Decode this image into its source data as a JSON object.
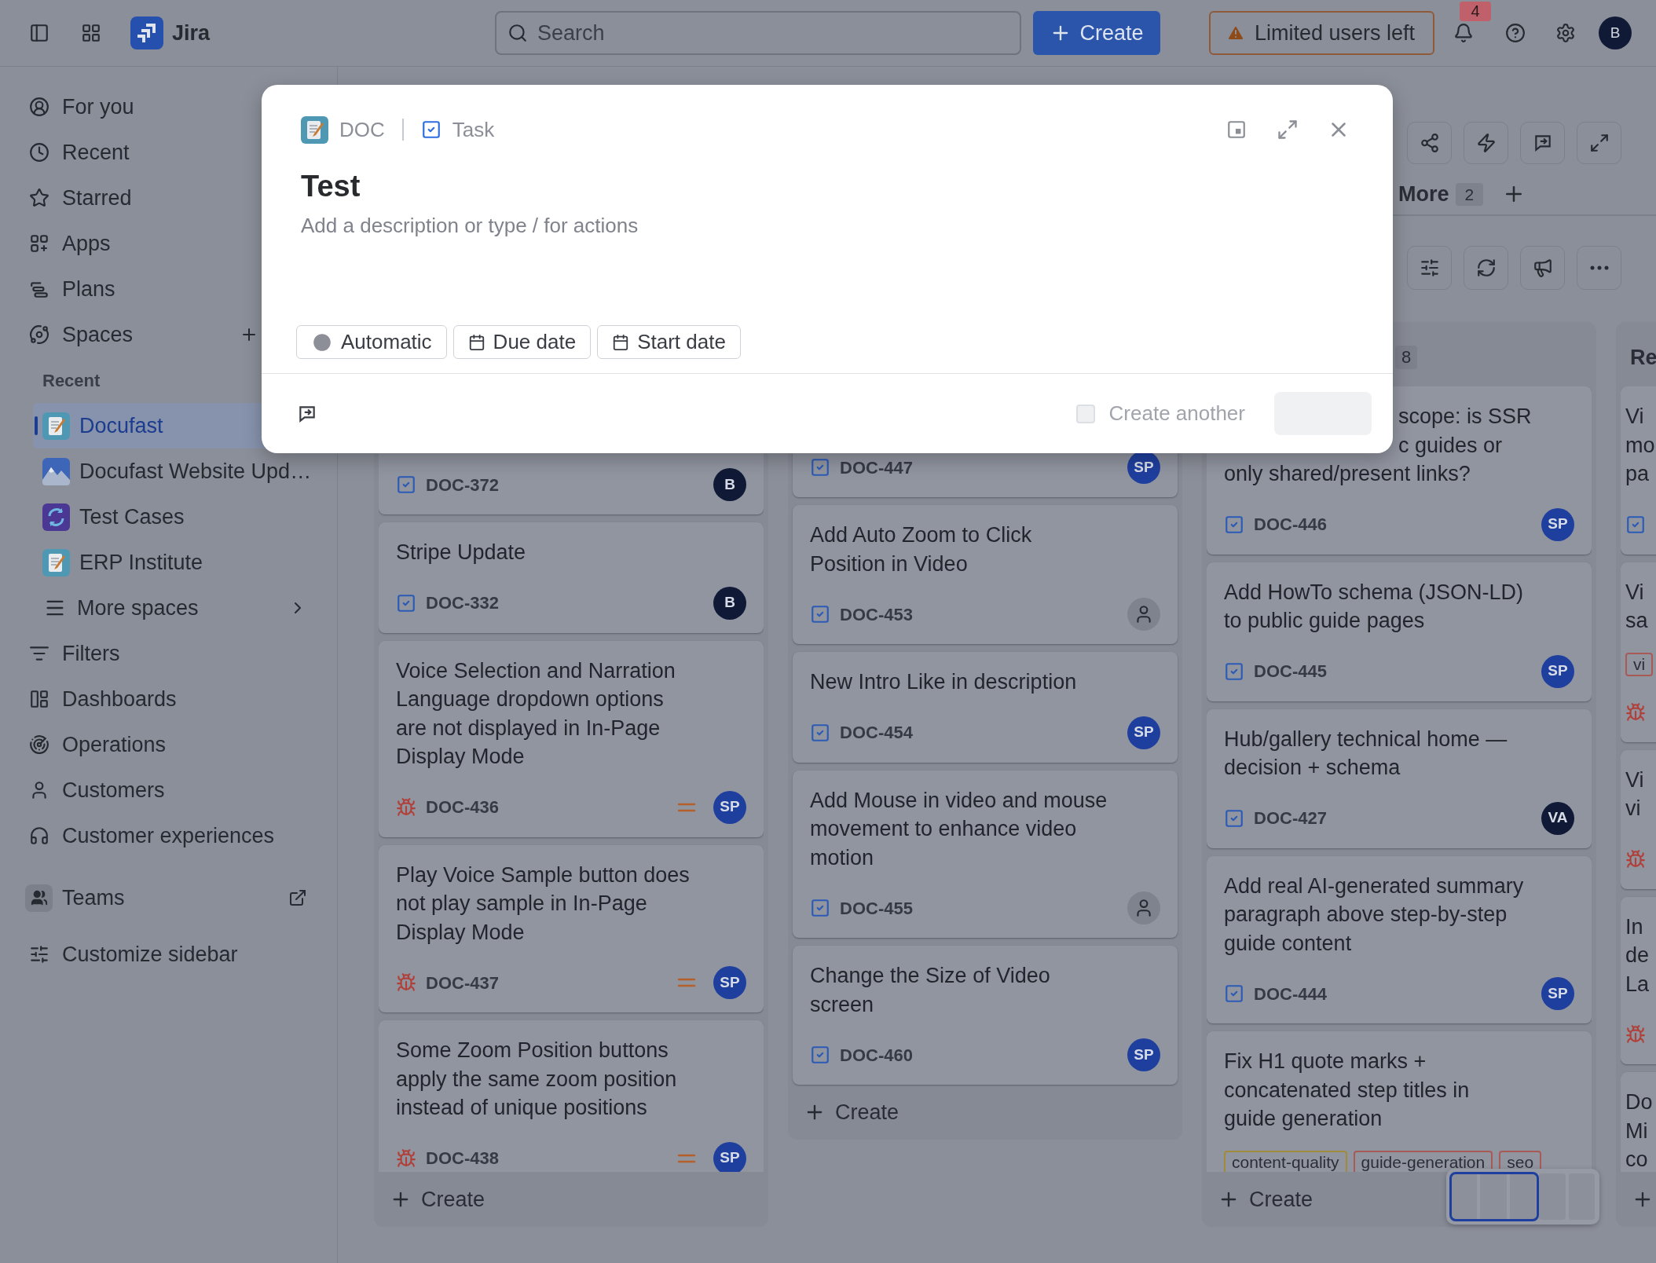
{
  "top_bar": {
    "product": "Jira",
    "search": {
      "placeholder": "Search"
    },
    "create_label": "Create",
    "notice": "Limited users left",
    "notification_count": "4",
    "avatar": "B"
  },
  "sidebar": {
    "nav": [
      {
        "label": "For you"
      },
      {
        "label": "Recent"
      },
      {
        "label": "Starred"
      },
      {
        "label": "Apps"
      },
      {
        "label": "Plans"
      },
      {
        "label": "Spaces"
      }
    ],
    "recent_heading": "Recent",
    "spaces": [
      {
        "label": "Docufast",
        "selected": true
      },
      {
        "label": "Docufast Website Upd…",
        "selected": false
      },
      {
        "label": "Test Cases",
        "selected": false
      },
      {
        "label": "ERP Institute",
        "selected": false
      }
    ],
    "more_spaces": "More spaces",
    "nav_bottom": [
      {
        "label": "Filters"
      },
      {
        "label": "Dashboards"
      },
      {
        "label": "Operations"
      },
      {
        "label": "Customers"
      },
      {
        "label": "Customer experiences"
      }
    ],
    "teams": "Teams",
    "customize": "Customize sidebar"
  },
  "board": {
    "more_tab": {
      "label": "More",
      "count": "2"
    },
    "columns": [
      {
        "create_label": "Create",
        "cards": [
          {
            "key": "DOC-372",
            "kind": "task",
            "assignee": {
              "initials": "B",
              "color": "#101a36"
            }
          },
          {
            "title": "Stripe Update",
            "key": "DOC-332",
            "kind": "task",
            "assignee": {
              "initials": "B",
              "color": "#101a36"
            }
          },
          {
            "title": "Voice Selection and Narration Language dropdown options are not displayed in In-Page Display Mode",
            "key": "DOC-436",
            "kind": "bug",
            "medium_priority": true,
            "assignee": {
              "initials": "SP",
              "color": "#1f3f9e"
            }
          },
          {
            "title": "Play Voice Sample button does not play sample in In-Page Display Mode",
            "key": "DOC-437",
            "kind": "bug",
            "medium_priority": true,
            "assignee": {
              "initials": "SP",
              "color": "#1f3f9e"
            }
          },
          {
            "title": "Some Zoom Position buttons apply the same zoom position instead of unique positions",
            "key": "DOC-438",
            "kind": "bug",
            "medium_priority": true,
            "assignee": {
              "initials": "SP",
              "color": "#1f3f9e"
            }
          }
        ]
      },
      {
        "create_label": "Create",
        "cards": [
          {
            "key": "DOC-447",
            "kind": "task",
            "assignee": {
              "initials": "SP",
              "color": "#1f3f9e"
            }
          },
          {
            "title": "Add Auto Zoom to Click Position in Video",
            "key": "DOC-453",
            "kind": "task",
            "assignee": {
              "kind": "unassigned"
            }
          },
          {
            "title": "New Intro Like in description",
            "key": "DOC-454",
            "kind": "task",
            "assignee": {
              "initials": "SP",
              "color": "#1f3f9e"
            }
          },
          {
            "title": "Add Mouse in video and mouse movement to enhance video motion",
            "key": "DOC-455",
            "kind": "task",
            "assignee": {
              "kind": "unassigned"
            }
          },
          {
            "title": "Change the Size of Video screen",
            "key": "DOC-460",
            "kind": "task",
            "assignee": {
              "initials": "SP",
              "color": "#1f3f9e"
            }
          }
        ]
      },
      {
        "count": "8",
        "create_label": "Create",
        "cards": [
          {
            "title_fragments": [
              {
                "text": "scope: is SSR",
                "covered": true
              },
              {
                "text": "c guides or",
                "covered": true
              },
              {
                "text": "only shared/present links?",
                "covered": false
              }
            ],
            "key": "DOC-446",
            "kind": "task",
            "assignee": {
              "initials": "SP",
              "color": "#1f3f9e"
            }
          },
          {
            "title": "Add HowTo schema (JSON-LD) to public guide pages",
            "key": "DOC-445",
            "kind": "task",
            "assignee": {
              "initials": "SP",
              "color": "#1f3f9e"
            }
          },
          {
            "title": "Hub/gallery technical home — decision + schema",
            "key": "DOC-427",
            "kind": "task",
            "assignee": {
              "initials": "VA",
              "color": "#101a36"
            }
          },
          {
            "title": "Add real AI-generated summary paragraph above step-by-step guide content",
            "key": "DOC-444",
            "kind": "task",
            "assignee": {
              "initials": "SP",
              "color": "#1f3f9e"
            }
          },
          {
            "title": "Fix H1 quote marks + concatenated step titles in guide generation",
            "tags": [
              {
                "label": "content-quality",
                "color": "#a08a3c"
              },
              {
                "label": "guide-generation",
                "color": "#a85a57"
              },
              {
                "label": "seo",
                "color": "#a85a57"
              }
            ]
          }
        ]
      },
      {
        "title": "Re",
        "cards": [
          {
            "title_fragments": [
              {
                "text": "Vi"
              },
              {
                "text": "mo"
              },
              {
                "text": "pa"
              }
            ],
            "kind": "task"
          },
          {
            "title_fragments": [
              {
                "text": "Vi"
              },
              {
                "text": "sa"
              }
            ],
            "tags": [
              {
                "label": "vi",
                "color": "#a85a57"
              }
            ],
            "kind": "bug"
          },
          {
            "title_fragments": [
              {
                "text": "Vi"
              },
              {
                "text": "vi"
              }
            ],
            "kind": "bug"
          },
          {
            "title_fragments": [
              {
                "text": "In"
              },
              {
                "text": "de"
              },
              {
                "text": "La"
              }
            ],
            "kind": "bug"
          },
          {
            "title_fragments": [
              {
                "text": "Do"
              },
              {
                "text": "Mi"
              },
              {
                "text": "co"
              }
            ]
          }
        ]
      }
    ]
  },
  "modal": {
    "breadcrumb": [
      "DOC",
      "Task"
    ],
    "title": "Test",
    "description_placeholder": "Add a description or type / for actions",
    "chips": [
      "Automatic",
      "Due date",
      "Start date"
    ],
    "create_another": {
      "label": "Create another",
      "checked": false
    }
  }
}
